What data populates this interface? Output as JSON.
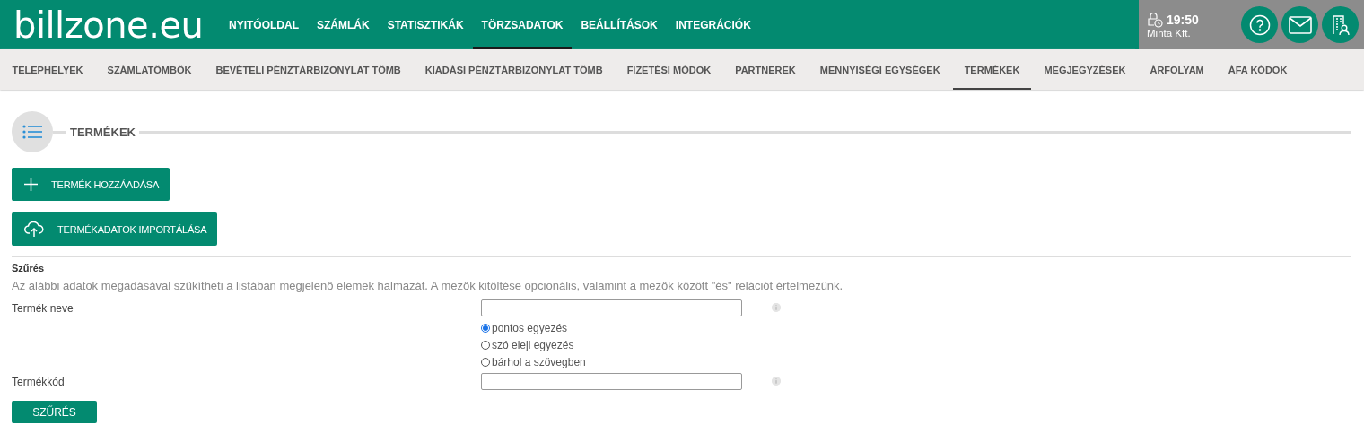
{
  "header": {
    "logo": "billzone.eu",
    "nav": [
      {
        "label": "NYITÓOLDAL",
        "selected": false
      },
      {
        "label": "SZÁMLÁK",
        "selected": false
      },
      {
        "label": "STATISZTIKÁK",
        "selected": false
      },
      {
        "label": "TÖRZSADATOK",
        "selected": true
      },
      {
        "label": "BEÁLLÍTÁSOK",
        "selected": false
      },
      {
        "label": "INTEGRÁCIÓK",
        "selected": false
      }
    ],
    "session": {
      "time": "19:50",
      "company": "Minta Kft."
    }
  },
  "subnav": [
    {
      "label": "TELEPHELYEK",
      "selected": false
    },
    {
      "label": "SZÁMLATÖMBÖK",
      "selected": false
    },
    {
      "label": "BEVÉTELI PÉNZTÁRBIZONYLAT TÖMB",
      "selected": false
    },
    {
      "label": "KIADÁSI PÉNZTÁRBIZONYLAT TÖMB",
      "selected": false
    },
    {
      "label": "FIZETÉSI MÓDOK",
      "selected": false
    },
    {
      "label": "PARTNEREK",
      "selected": false
    },
    {
      "label": "MENNYISÉGI EGYSÉGEK",
      "selected": false
    },
    {
      "label": "TERMÉKEK",
      "selected": true
    },
    {
      "label": "MEGJEGYZÉSEK",
      "selected": false
    },
    {
      "label": "ÁRFOLYAM",
      "selected": false
    },
    {
      "label": "ÁFA KÓDOK",
      "selected": false
    }
  ],
  "section_title": "TERMÉKEK",
  "actions": [
    {
      "kind": "add",
      "label": "TERMÉK HOZZÁADÁSA"
    },
    {
      "kind": "import",
      "label": "TERMÉKADATOK IMPORTÁLÁSA"
    }
  ],
  "filter": {
    "title": "Szűrés",
    "description": "Az alábbi adatok megadásával szűkítheti a listában megjelenő elemek halmazát. A mezők kitöltése opcionális, valamint a mezők között \"és\" relációt értelmezünk.",
    "fields": [
      {
        "label": "Termék neve",
        "options": [
          {
            "label": "pontos egyezés",
            "selected": true
          },
          {
            "label": "szó eleji egyezés",
            "selected": false
          },
          {
            "label": "bárhol a szövegben",
            "selected": false
          }
        ]
      },
      {
        "label": "Termékkód"
      }
    ],
    "button": "SZŰRÉS"
  }
}
